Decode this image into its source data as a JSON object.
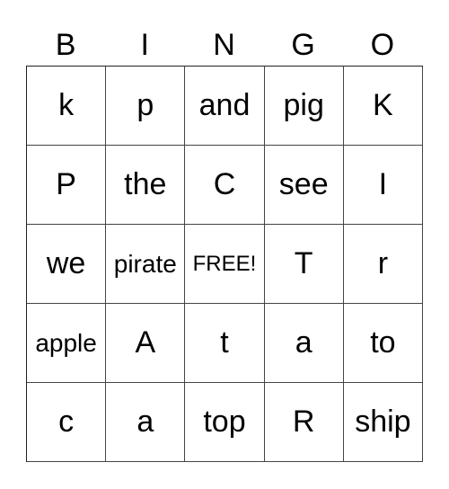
{
  "header": [
    "B",
    "I",
    "N",
    "G",
    "O"
  ],
  "cells": [
    [
      "k",
      "p",
      "and",
      "pig",
      "K"
    ],
    [
      "P",
      "the",
      "C",
      "see",
      "I"
    ],
    [
      "we",
      "pirate",
      "FREE!",
      "T",
      "r"
    ],
    [
      "apple",
      "A",
      "t",
      "a",
      "to"
    ],
    [
      "c",
      "a",
      "top",
      "R",
      "ship"
    ]
  ]
}
